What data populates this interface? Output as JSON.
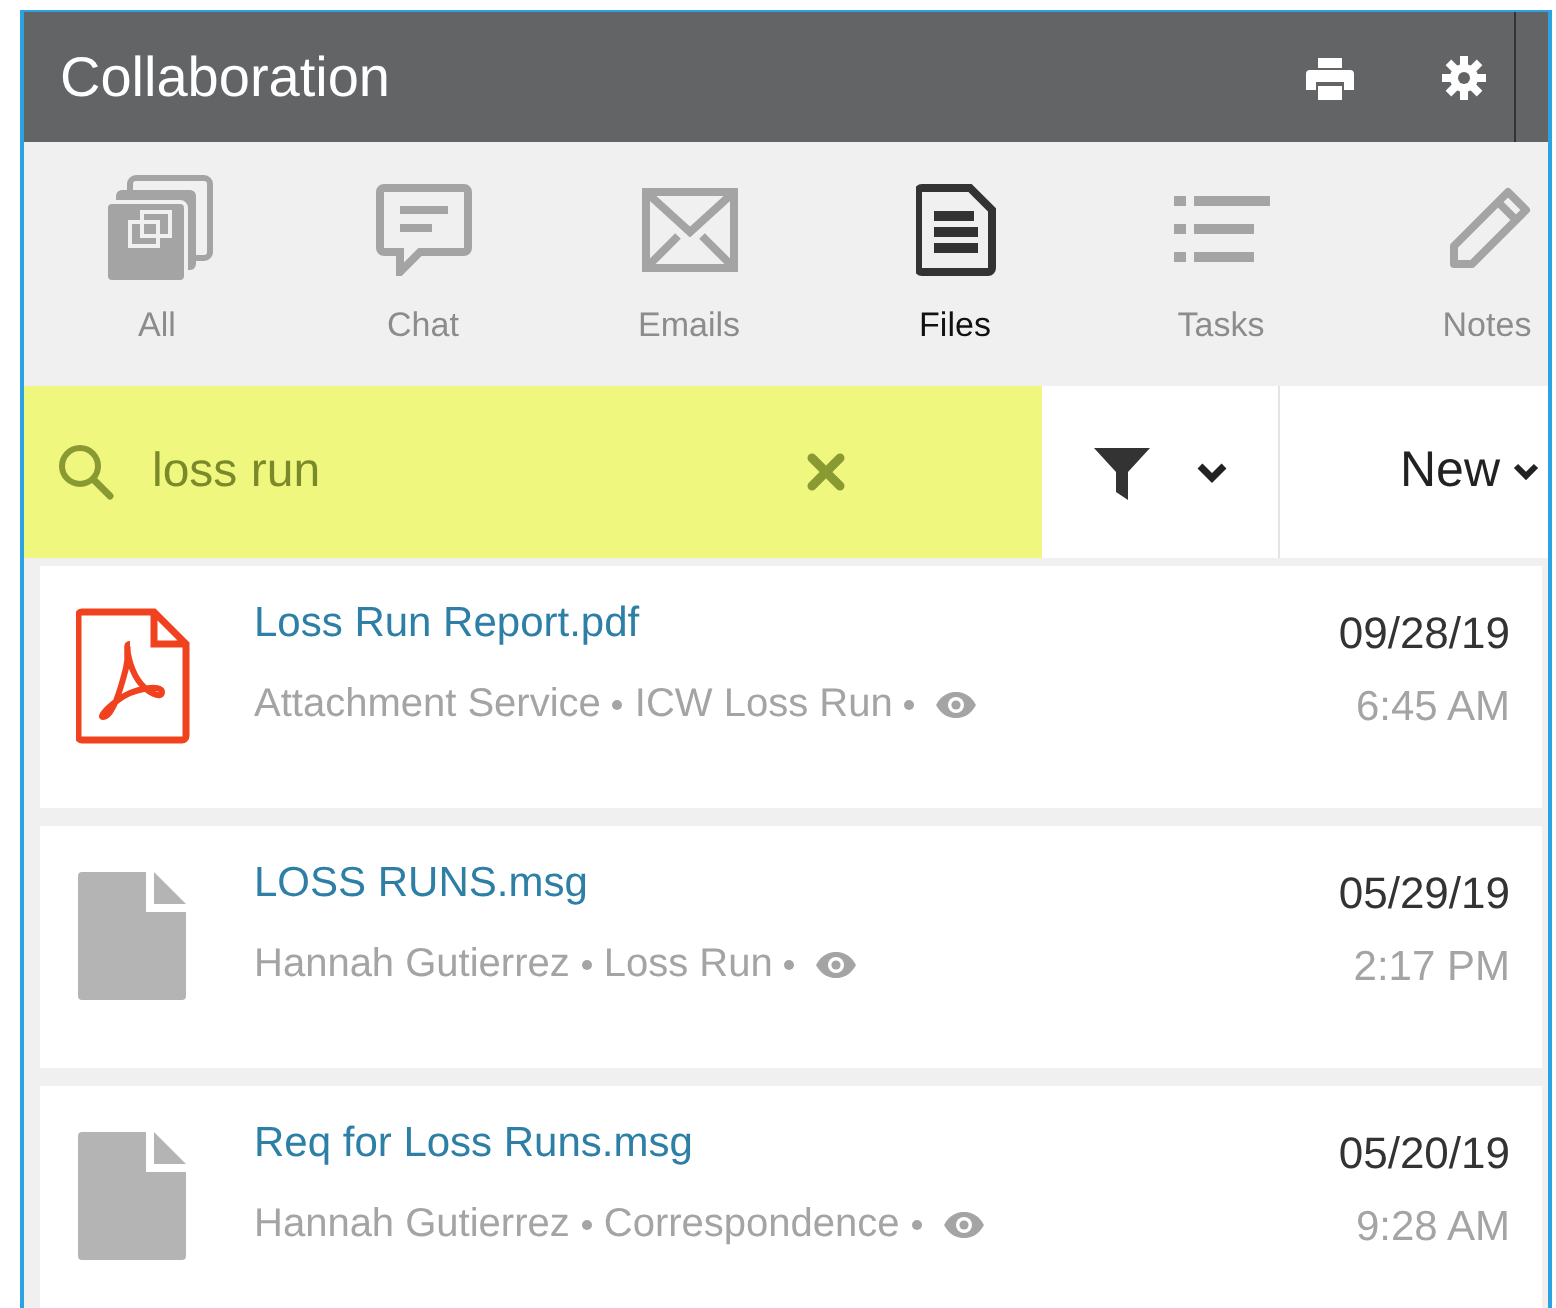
{
  "header": {
    "title": "Collaboration"
  },
  "tabs": [
    {
      "kind": "all",
      "label": "All",
      "selected": false
    },
    {
      "kind": "chat",
      "label": "Chat",
      "selected": false
    },
    {
      "kind": "emails",
      "label": "Emails",
      "selected": false
    },
    {
      "kind": "files",
      "label": "Files",
      "selected": true
    },
    {
      "kind": "tasks",
      "label": "Tasks",
      "selected": false
    },
    {
      "kind": "notes",
      "label": "Notes",
      "selected": false
    }
  ],
  "search": {
    "value": "loss run"
  },
  "new_button": {
    "label": "New"
  },
  "files": [
    {
      "kind": "pdf",
      "name": "Loss Run Report.pdf",
      "author": "Attachment Service",
      "category": "ICW Loss Run",
      "date": "09/28/19",
      "time": "6:45 AM"
    },
    {
      "kind": "document",
      "name": "LOSS RUNS.msg",
      "author": "Hannah Gutierrez",
      "category": "Loss Run",
      "date": "05/29/19",
      "time": "2:17 PM"
    },
    {
      "kind": "document",
      "name": "Req for Loss Runs.msg",
      "author": "Hannah Gutierrez",
      "category": "Correspondence",
      "date": "05/20/19",
      "time": "9:28 AM"
    }
  ]
}
